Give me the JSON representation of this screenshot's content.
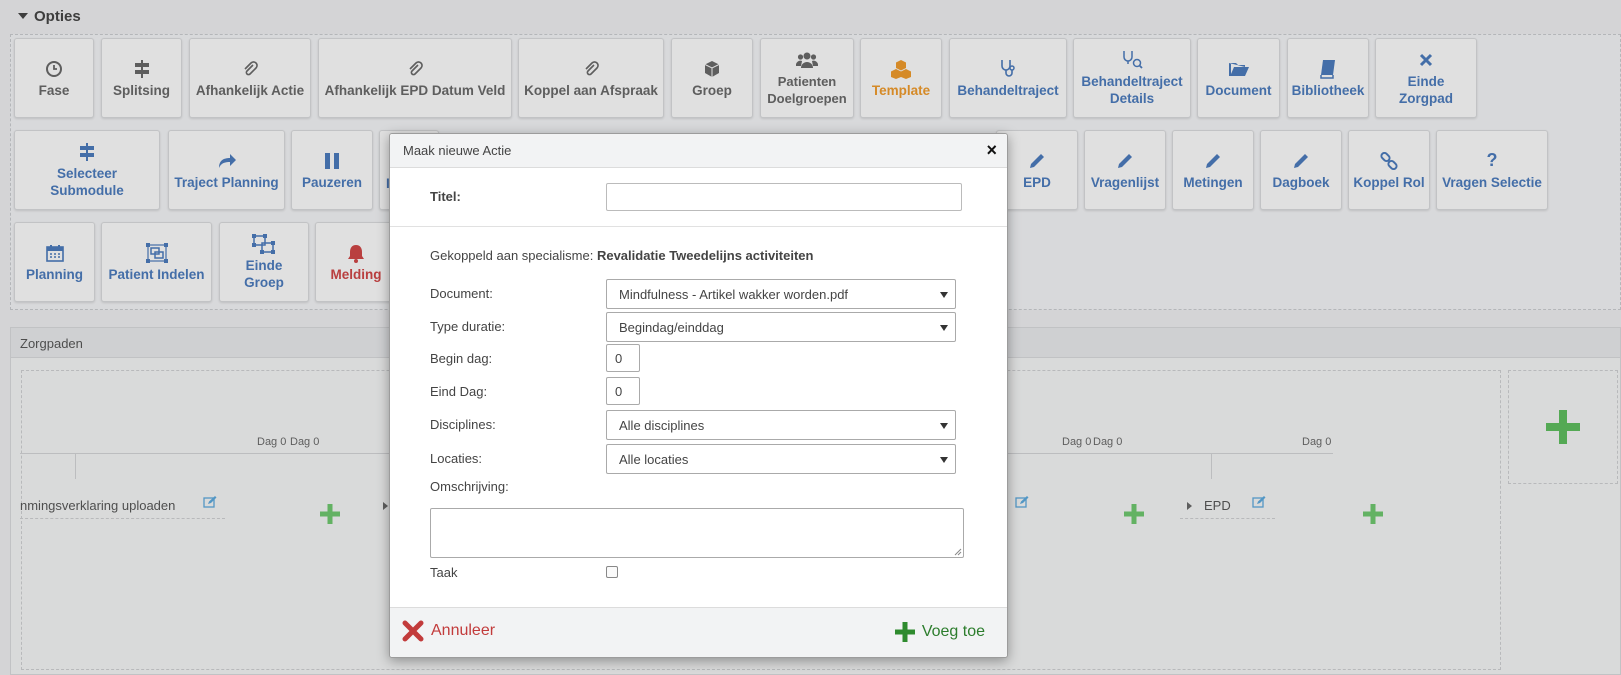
{
  "options": {
    "title": "Opties",
    "row1": [
      {
        "label": "Fase",
        "icon": "clock-icon",
        "color": "grey"
      },
      {
        "label": "Splitsing",
        "icon": "signpost-icon",
        "color": "grey"
      },
      {
        "label": "Afhankelijk Actie",
        "icon": "paperclip-icon",
        "color": "grey"
      },
      {
        "label": "Afhankelijk EPD Datum Veld",
        "icon": "paperclip-icon",
        "color": "grey"
      },
      {
        "label": "Koppel aan Afspraak",
        "icon": "paperclip-icon",
        "color": "grey"
      },
      {
        "label": "Groep",
        "icon": "cube-icon",
        "color": "grey"
      },
      {
        "label": "Patienten Doelgroepen",
        "icon": "users-icon",
        "color": "grey"
      },
      {
        "label": "Template",
        "icon": "cubes-icon",
        "color": "orange"
      },
      {
        "label": "Behandeltraject",
        "icon": "stethoscope-icon",
        "color": "blue"
      },
      {
        "label": "Behandeltraject Details",
        "icon": "stethoscope-search-icon",
        "color": "blue"
      },
      {
        "label": "Document",
        "icon": "folder-open-icon",
        "color": "blue"
      },
      {
        "label": "Bibliotheek",
        "icon": "book-icon",
        "color": "blue"
      },
      {
        "label": "Einde Zorgpad",
        "icon": "close-icon",
        "color": "blue"
      }
    ],
    "row2": [
      {
        "label": "Selecteer Submodule",
        "icon": "signpost-icon",
        "color": "blue"
      },
      {
        "label": "Traject Planning",
        "icon": "share-arrow-icon",
        "color": "blue"
      },
      {
        "label": "Pauzeren",
        "icon": "pause-icon",
        "color": "blue"
      },
      {
        "label": "I",
        "icon": "",
        "color": "blue"
      },
      {
        "label": "EPD",
        "icon": "pencil-icon",
        "color": "blue"
      },
      {
        "label": "Vragenlijst",
        "icon": "pencil-icon",
        "color": "blue"
      },
      {
        "label": "Metingen",
        "icon": "pencil-icon",
        "color": "blue"
      },
      {
        "label": "Dagboek",
        "icon": "pencil-icon",
        "color": "blue"
      },
      {
        "label": "Koppel Rol",
        "icon": "link-icon",
        "color": "blue"
      },
      {
        "label": "Vragen Selectie",
        "icon": "question-icon",
        "color": "blue"
      }
    ],
    "row3": [
      {
        "label": "Planning",
        "icon": "calendar-icon",
        "color": "blue"
      },
      {
        "label": "Patient Indelen",
        "icon": "object-group-icon",
        "color": "blue"
      },
      {
        "label": "Einde Groep",
        "icon": "object-ungroup-icon",
        "color": "blue"
      },
      {
        "label": "Melding",
        "icon": "bell-icon",
        "color": "red"
      }
    ]
  },
  "zorgpaden": {
    "title": "Zorgpaden",
    "dag_labels": [
      "Dag 0",
      "Dag 0",
      "Dag 0",
      "Dag 0",
      "Dag 0"
    ],
    "step1_label": "nmingsverklaring uploaden",
    "step2_label": "EPD"
  },
  "modal": {
    "title": "Maak nieuwe Actie",
    "close": "×",
    "titel_label": "Titel:",
    "titel_value": "",
    "specialism_prefix": "Gekoppeld aan specialisme:",
    "specialism_value": "Revalidatie Tweedelijns activiteiten",
    "document_label": "Document:",
    "document_value": "Mindfulness - Artikel wakker worden.pdf",
    "type_duratie_label": "Type duratie:",
    "type_duratie_value": "Begindag/einddag",
    "begin_dag_label": "Begin dag:",
    "begin_dag_value": "0",
    "eind_dag_label": "Eind Dag:",
    "eind_dag_value": "0",
    "disciplines_label": "Disciplines:",
    "disciplines_value": "Alle disciplines",
    "locaties_label": "Locaties:",
    "locaties_value": "Alle locaties",
    "omschrijving_label": "Omschrijving:",
    "taak_label": "Taak",
    "taak_checked": false,
    "cancel_label": "Annuleer",
    "add_label": "Voeg toe"
  },
  "colors": {
    "blue": "#4a78b7",
    "orange": "#e8962b",
    "red": "#c94545",
    "green": "#5cb85c"
  }
}
